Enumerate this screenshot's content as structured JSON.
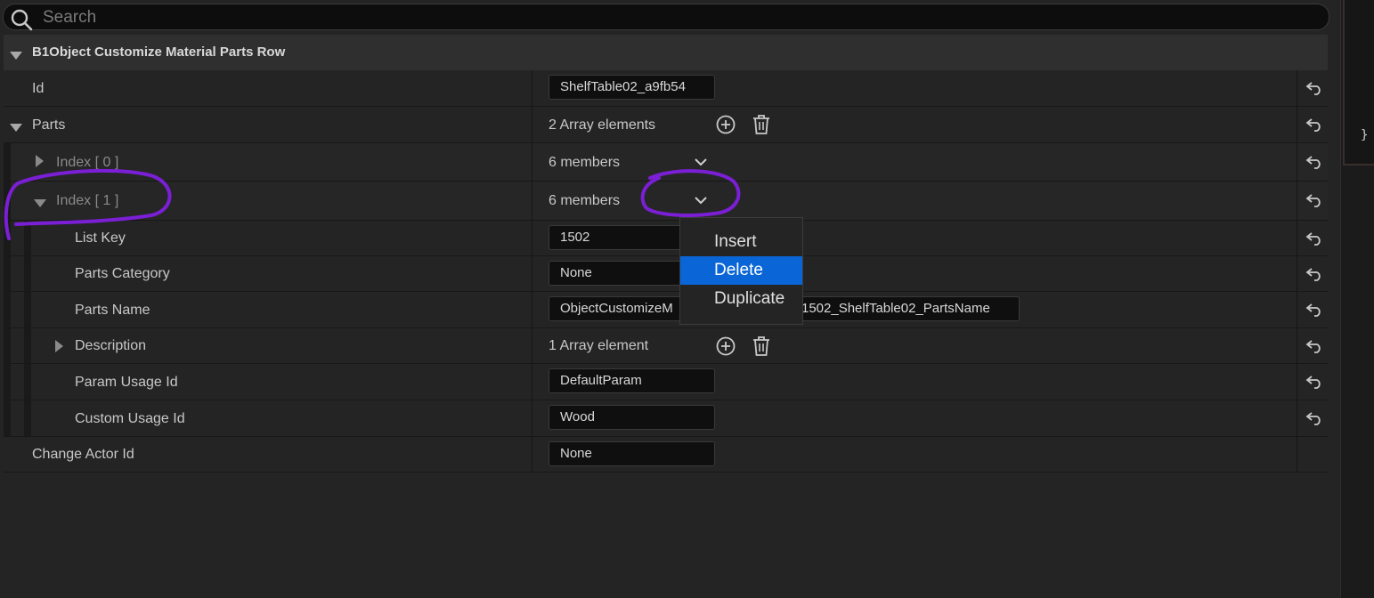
{
  "search": {
    "placeholder": "Search"
  },
  "section": {
    "title": "B1Object Customize Material Parts Row"
  },
  "rows": {
    "id": {
      "label": "Id",
      "value": "ShelfTable02_a9fb54"
    },
    "parts": {
      "label": "Parts",
      "value": "2 Array elements"
    },
    "index0": {
      "label": "Index [ 0 ]",
      "value": "6 members"
    },
    "index1": {
      "label": "Index [ 1 ]",
      "value": "6 members"
    },
    "list_key": {
      "label": "List Key",
      "value": "1502"
    },
    "parts_category": {
      "label": "Parts Category",
      "value": "None"
    },
    "parts_name": {
      "label": "Parts Name",
      "value_left": "ObjectCustomizeM",
      "value_right": "1502_ShelfTable02_PartsName"
    },
    "description": {
      "label": "Description",
      "value": "1 Array element"
    },
    "param_usage_id": {
      "label": "Param Usage Id",
      "value": "DefaultParam"
    },
    "custom_usage_id": {
      "label": "Custom Usage Id",
      "value": "Wood"
    },
    "change_actor_id": {
      "label": "Change Actor Id",
      "value": "None"
    }
  },
  "context_menu": {
    "items": [
      "Insert",
      "Delete",
      "Duplicate"
    ],
    "selected": "Delete"
  },
  "right_panel": {
    "brace": "}"
  },
  "colors": {
    "selection": "#0a66d6",
    "annotation": "#7b1fd6"
  },
  "icons": [
    "search-icon",
    "reset-arrow-icon",
    "add-circle-icon",
    "trash-icon",
    "chevron-down-icon",
    "triangle-expand-icon"
  ]
}
